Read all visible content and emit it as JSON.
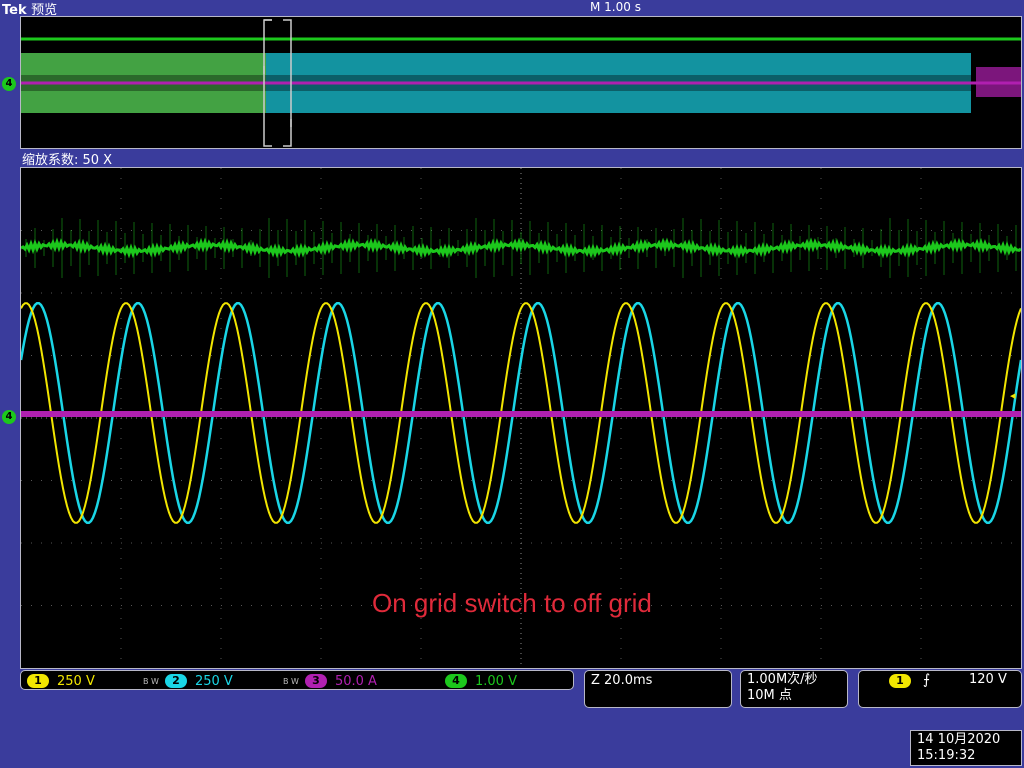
{
  "brand": "Tek",
  "mode": "预览",
  "timebase": "M 1.00 s",
  "zoom_label": "缩放系数: 50 X",
  "annotation": "On grid switch to off grid",
  "ch4_marker": "4",
  "channels": [
    {
      "num": "1",
      "scale": "250 V",
      "bw": "",
      "color": "#f2e600"
    },
    {
      "num": "2",
      "scale": "250 V",
      "bw": "B W",
      "color": "#1ad6e6"
    },
    {
      "num": "3",
      "scale": "50.0 A",
      "bw": "B W",
      "color": "#b020b0"
    },
    {
      "num": "4",
      "scale": "1.00 V",
      "bw": "",
      "color": "#1cc81c"
    }
  ],
  "zoom_time": "Z 20.0ms",
  "sample_rate": "1.00M次/秒",
  "record_length": "10M 点",
  "trigger": {
    "channel": "1",
    "slope": "rising-edge-icon",
    "level": "120 V"
  },
  "date": "14 10月2020",
  "time": "15:19:32",
  "colors": {
    "ch1": "#f2e600",
    "ch2": "#1ad6e6",
    "ch3": "#b020b0",
    "ch4": "#1cc81c",
    "annotation": "#e02a3a"
  }
}
